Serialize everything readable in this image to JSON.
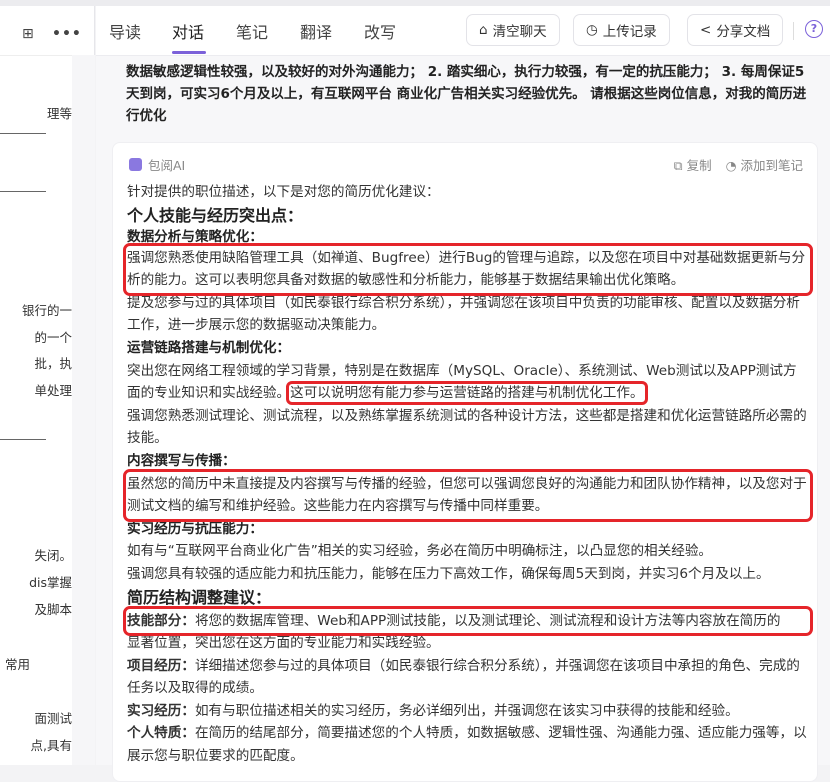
{
  "left": {
    "fragments": [
      "理等",
      "银行的一",
      "的一个",
      "批，执",
      "单处理",
      "失闭。",
      "dis掌握",
      "及脚本",
      "常用",
      "面测试",
      "点,具有"
    ]
  },
  "header": {
    "tabs": [
      "导读",
      "对话",
      "笔记",
      "翻译",
      "改写"
    ],
    "active_tab": "对话",
    "buttons": {
      "clear": "清空聊天",
      "history": "上传记录",
      "share": "分享文档"
    },
    "help": "?",
    "accent": "#7b61d9"
  },
  "question": "数据敏感逻辑性较强，以及较好的对外沟通能力； 2. 踏实细心，执行力较强，有一定的抗压能力； 3. 每周保证5天到岗，可实习6个月及以上，有互联网平台 商业化广告相关实习经验优先。 请根据这些岗位信息，对我的简历进行优化",
  "answer": {
    "bot_name": "包阅AI",
    "copy": "复制",
    "add_note": "添加到笔记",
    "intro": "针对提供的职位描述，以下是对您的简历优化建议：",
    "h1": "个人技能与经历突出点：",
    "s1": {
      "title": "数据分析与策略优化：",
      "p1": "强调您熟悉使用缺陷管理工具（如禅道、Bugfree）进行Bug的管理与追踪，以及您在项目中对基础数据更新与分析的能力。这可以表明您具备对数据的敏感性和分析能力，能够基于数据结果输出优化策略。",
      "p2": "提及您参与过的具体项目（如民泰银行综合积分系统），并强调您在该项目中负责的功能审核、配置以及数据分析工作，进一步展示您的数据驱动决策能力。"
    },
    "s2": {
      "title": "运营链路搭建与机制优化：",
      "p1a": "突出您在网络工程领域的学习背景，特别是在数据库（MySQL、Oracle）、系统测试、Web测试以及APP测试方面的专业知识和实战经验。",
      "p1b": "这可以说明您有能力参与运营链路的搭建与机制优化工作。",
      "p2": "强调您熟悉测试理论、测试流程，以及熟练掌握系统测试的各种设计方法，这些都是搭建和优化运营链路所必需的技能。"
    },
    "s3": {
      "title": "内容撰写与传播：",
      "p1": "虽然您的简历中未直接提及内容撰写与传播的经验，但您可以强调您良好的沟通能力和团队协作精神，以及您对于测试文档的编写和维护经验。这些能力在内容撰写与传播中同样重要。"
    },
    "s4": {
      "title": "实习经历与抗压能力：",
      "p1": "如有与“互联网平台商业化广告”相关的实习经验，务必在简历中明确标注，以凸显您的相关经验。",
      "p2": "强调您具有较强的适应能力和抗压能力，能够在压力下高效工作，确保每周5天到岗，并实习6个月及以上。"
    },
    "h2": "简历结构调整建议：",
    "items": [
      {
        "label": "技能部分：",
        "text1": "将您的数据库管理、Web和APP测试技能，以及测试理论、测试流程和设计方法等内容放在简历的",
        "text2": "显著位置，突出您在这方面的专业能力和实践经验。"
      },
      {
        "label": "项目经历：",
        "text": "详细描述您参与过的具体项目（如民泰银行综合积分系统），并强调您在该项目中承担的角色、完成的任务以及取得的成绩。"
      },
      {
        "label": "实习经历：",
        "text": "如有与职位描述相关的实习经历，务必详细列出，并强调您在该实习中获得的技能和经验。"
      },
      {
        "label": "个人特质：",
        "text": "在简历的结尾部分，简要描述您的个人特质，如数据敏感、逻辑性强、沟通能力强、适应能力强等，以展示您与职位要求的匹配度。"
      }
    ]
  },
  "highlight_color": "#e5252a"
}
